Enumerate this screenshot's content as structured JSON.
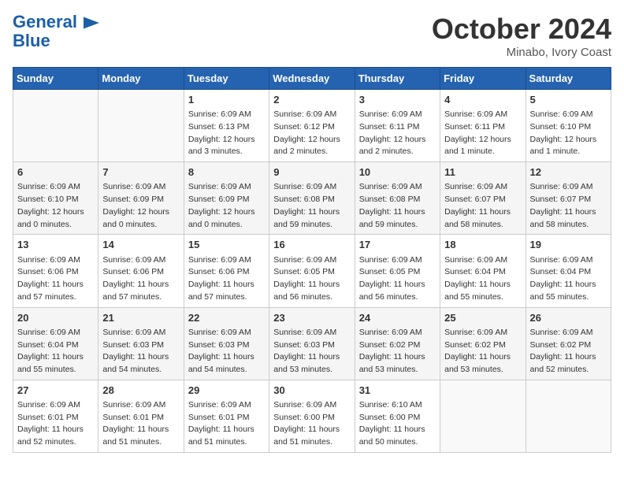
{
  "logo": {
    "line1": "General",
    "line2": "Blue"
  },
  "title": "October 2024",
  "subtitle": "Minabo, Ivory Coast",
  "weekdays": [
    "Sunday",
    "Monday",
    "Tuesday",
    "Wednesday",
    "Thursday",
    "Friday",
    "Saturday"
  ],
  "weeks": [
    [
      {
        "day": "",
        "info": ""
      },
      {
        "day": "",
        "info": ""
      },
      {
        "day": "1",
        "info": "Sunrise: 6:09 AM\nSunset: 6:13 PM\nDaylight: 12 hours\nand 3 minutes."
      },
      {
        "day": "2",
        "info": "Sunrise: 6:09 AM\nSunset: 6:12 PM\nDaylight: 12 hours\nand 2 minutes."
      },
      {
        "day": "3",
        "info": "Sunrise: 6:09 AM\nSunset: 6:11 PM\nDaylight: 12 hours\nand 2 minutes."
      },
      {
        "day": "4",
        "info": "Sunrise: 6:09 AM\nSunset: 6:11 PM\nDaylight: 12 hours\nand 1 minute."
      },
      {
        "day": "5",
        "info": "Sunrise: 6:09 AM\nSunset: 6:10 PM\nDaylight: 12 hours\nand 1 minute."
      }
    ],
    [
      {
        "day": "6",
        "info": "Sunrise: 6:09 AM\nSunset: 6:10 PM\nDaylight: 12 hours\nand 0 minutes."
      },
      {
        "day": "7",
        "info": "Sunrise: 6:09 AM\nSunset: 6:09 PM\nDaylight: 12 hours\nand 0 minutes."
      },
      {
        "day": "8",
        "info": "Sunrise: 6:09 AM\nSunset: 6:09 PM\nDaylight: 12 hours\nand 0 minutes."
      },
      {
        "day": "9",
        "info": "Sunrise: 6:09 AM\nSunset: 6:08 PM\nDaylight: 11 hours\nand 59 minutes."
      },
      {
        "day": "10",
        "info": "Sunrise: 6:09 AM\nSunset: 6:08 PM\nDaylight: 11 hours\nand 59 minutes."
      },
      {
        "day": "11",
        "info": "Sunrise: 6:09 AM\nSunset: 6:07 PM\nDaylight: 11 hours\nand 58 minutes."
      },
      {
        "day": "12",
        "info": "Sunrise: 6:09 AM\nSunset: 6:07 PM\nDaylight: 11 hours\nand 58 minutes."
      }
    ],
    [
      {
        "day": "13",
        "info": "Sunrise: 6:09 AM\nSunset: 6:06 PM\nDaylight: 11 hours\nand 57 minutes."
      },
      {
        "day": "14",
        "info": "Sunrise: 6:09 AM\nSunset: 6:06 PM\nDaylight: 11 hours\nand 57 minutes."
      },
      {
        "day": "15",
        "info": "Sunrise: 6:09 AM\nSunset: 6:06 PM\nDaylight: 11 hours\nand 57 minutes."
      },
      {
        "day": "16",
        "info": "Sunrise: 6:09 AM\nSunset: 6:05 PM\nDaylight: 11 hours\nand 56 minutes."
      },
      {
        "day": "17",
        "info": "Sunrise: 6:09 AM\nSunset: 6:05 PM\nDaylight: 11 hours\nand 56 minutes."
      },
      {
        "day": "18",
        "info": "Sunrise: 6:09 AM\nSunset: 6:04 PM\nDaylight: 11 hours\nand 55 minutes."
      },
      {
        "day": "19",
        "info": "Sunrise: 6:09 AM\nSunset: 6:04 PM\nDaylight: 11 hours\nand 55 minutes."
      }
    ],
    [
      {
        "day": "20",
        "info": "Sunrise: 6:09 AM\nSunset: 6:04 PM\nDaylight: 11 hours\nand 55 minutes."
      },
      {
        "day": "21",
        "info": "Sunrise: 6:09 AM\nSunset: 6:03 PM\nDaylight: 11 hours\nand 54 minutes."
      },
      {
        "day": "22",
        "info": "Sunrise: 6:09 AM\nSunset: 6:03 PM\nDaylight: 11 hours\nand 54 minutes."
      },
      {
        "day": "23",
        "info": "Sunrise: 6:09 AM\nSunset: 6:03 PM\nDaylight: 11 hours\nand 53 minutes."
      },
      {
        "day": "24",
        "info": "Sunrise: 6:09 AM\nSunset: 6:02 PM\nDaylight: 11 hours\nand 53 minutes."
      },
      {
        "day": "25",
        "info": "Sunrise: 6:09 AM\nSunset: 6:02 PM\nDaylight: 11 hours\nand 53 minutes."
      },
      {
        "day": "26",
        "info": "Sunrise: 6:09 AM\nSunset: 6:02 PM\nDaylight: 11 hours\nand 52 minutes."
      }
    ],
    [
      {
        "day": "27",
        "info": "Sunrise: 6:09 AM\nSunset: 6:01 PM\nDaylight: 11 hours\nand 52 minutes."
      },
      {
        "day": "28",
        "info": "Sunrise: 6:09 AM\nSunset: 6:01 PM\nDaylight: 11 hours\nand 51 minutes."
      },
      {
        "day": "29",
        "info": "Sunrise: 6:09 AM\nSunset: 6:01 PM\nDaylight: 11 hours\nand 51 minutes."
      },
      {
        "day": "30",
        "info": "Sunrise: 6:09 AM\nSunset: 6:00 PM\nDaylight: 11 hours\nand 51 minutes."
      },
      {
        "day": "31",
        "info": "Sunrise: 6:10 AM\nSunset: 6:00 PM\nDaylight: 11 hours\nand 50 minutes."
      },
      {
        "day": "",
        "info": ""
      },
      {
        "day": "",
        "info": ""
      }
    ]
  ]
}
